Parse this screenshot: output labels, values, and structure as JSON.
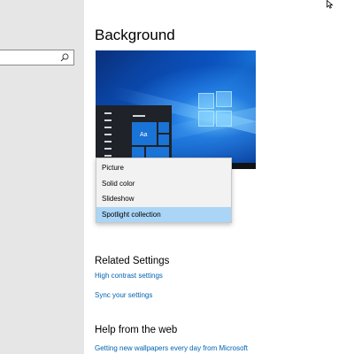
{
  "page": {
    "title": "Background"
  },
  "nav": {
    "search_placeholder": ""
  },
  "preview": {
    "tile_label": "Aa"
  },
  "dropdown": {
    "options": [
      "Picture",
      "Solid color",
      "Slideshow",
      "Spotlight collection"
    ],
    "selected": "Spotlight collection"
  },
  "related": {
    "heading": "Related Settings",
    "links": [
      "High contrast settings",
      "Sync your settings"
    ]
  },
  "help": {
    "heading": "Help from the web",
    "links": [
      "Getting new wallpapers every day from Microsoft"
    ]
  },
  "colors": {
    "accent": "#0063b1",
    "selected_bg": "#aad5f7",
    "nav_bg": "#e6e6e6"
  }
}
